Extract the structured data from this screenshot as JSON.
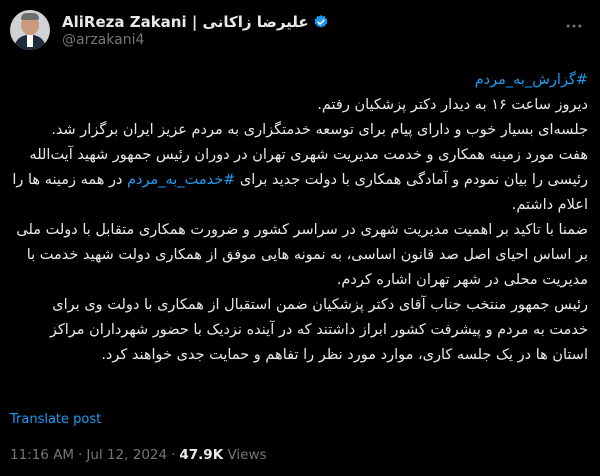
{
  "author": {
    "display_name": "AliReza Zakani | علیرضا زاکانی",
    "handle": "@arzakani4",
    "verified": true
  },
  "tweet": {
    "hashtag_top": "#گزارش_به_مردم",
    "para1_line1": "دیروز ساعت ۱۶ به دیدار دکتر پزشکیان رفتم.",
    "para1_line2": "جلسه‌ای بسیار خوب و دارای پیام برای توسعه خدمتگزاری به مردم عزیز ایران برگزار شد.",
    "para2_before": "هفت مورد زمینه همکاری و خدمت مدیریت شهری تهران در دوران رئیس جمهور شهید آیت‌الله رئیسی را بیان نمودم و آمادگی همکاری با دولت جدید برای ",
    "para2_hashtag": "#خدمت_به_مردم",
    "para2_after": " در همه زمینه ها را اعلام داشتم.",
    "para3": "ضمنا با تاکید بر اهمیت مدیریت شهری در سراسر کشور و ضرورت همکاری متقابل با دولت ملی بر اساس احیای اصل صد قانون اساسی، به نمونه هایی موفق از همکاری دولت شهید خدمت با مدیریت محلی در شهر تهران اشاره کردم.",
    "para4": "رئیس جمهور منتخب جناب آقای دکتر پزشکیان ضمن استقبال از همکاری با دولت وی برای خدمت به مردم و پیشرفت کشور ابراز داشتند که در آینده نزدیک با حضور شهرداران مراکز استان ها در یک جلسه کاری، موارد مورد نظر را تفاهم و حمایت جدی خواهند کرد."
  },
  "translate_label": "Translate post",
  "meta": {
    "time": "11:16 AM",
    "date": "Jul 12, 2024",
    "views_count": "47.9K",
    "views_label": "Views"
  },
  "colors": {
    "background": "#000000",
    "text": "#e7e9ea",
    "secondary": "#71767b",
    "link": "#1d9bf0",
    "verified": "#1d9bf0"
  }
}
